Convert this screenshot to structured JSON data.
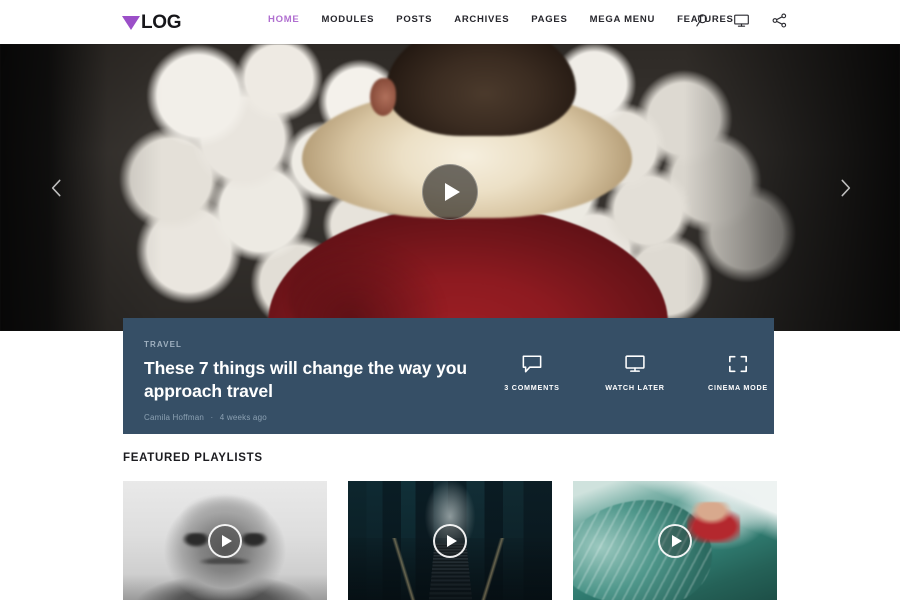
{
  "site": {
    "logo_text": "LOG",
    "logo_mark": "triangle-down-icon",
    "accent_color": "#b06fd0",
    "card_color": "#364f66"
  },
  "nav": {
    "items": [
      {
        "label": "HOME",
        "active": true
      },
      {
        "label": "MODULES",
        "active": false
      },
      {
        "label": "POSTS",
        "active": false
      },
      {
        "label": "ARCHIVES",
        "active": false
      },
      {
        "label": "PAGES",
        "active": false
      },
      {
        "label": "MEGA MENU",
        "active": false
      },
      {
        "label": "FEATURES",
        "active": false
      }
    ],
    "icons": [
      {
        "name": "search-icon"
      },
      {
        "name": "monitor-icon"
      },
      {
        "name": "share-icon"
      }
    ]
  },
  "hero": {
    "prev_label": "chevron-left-icon",
    "next_label": "chevron-right-icon",
    "play_label": "play-icon"
  },
  "feature": {
    "category": "TRAVEL",
    "title": "These 7 things will change the way you approach travel",
    "author": "Camila Hoffman",
    "separator": "·",
    "time_ago": "4 weeks ago",
    "actions": [
      {
        "label": "3 COMMENTS",
        "icon": "comment-icon"
      },
      {
        "label": "WATCH LATER",
        "icon": "monitor-icon"
      },
      {
        "label": "CINEMA MODE",
        "icon": "expand-icon"
      }
    ]
  },
  "playlists": {
    "heading": "FEATURED PLAYLISTS",
    "items": [
      {
        "thumb": "portrait-bw-elderly-man",
        "play_label": "play-icon"
      },
      {
        "thumb": "terminal-escalator-night",
        "play_label": "play-icon"
      },
      {
        "thumb": "surfer-on-wave",
        "play_label": "play-icon"
      }
    ]
  }
}
